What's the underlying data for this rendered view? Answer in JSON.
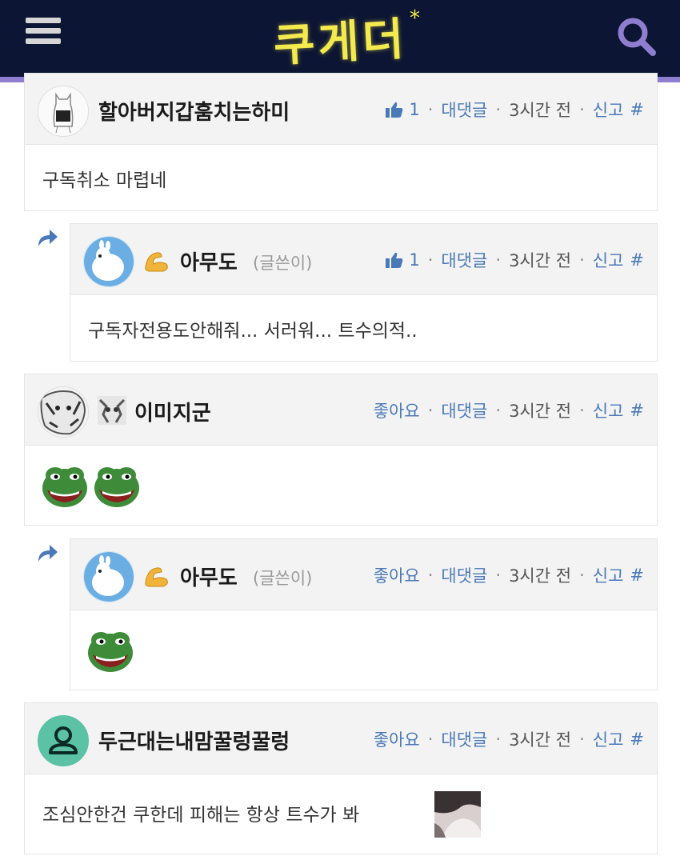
{
  "header": {
    "logo_text": "쿠게더",
    "logo_star": "*",
    "colors": {
      "bar": "#0c1533",
      "accent": "#8f7ed0",
      "logo": "#f3ea4e"
    },
    "icons": {
      "menu": "hamburger-icon",
      "search": "search-icon"
    }
  },
  "comments": [
    {
      "name": "할아버지갑훔치는하미",
      "likes": "1",
      "reply": "대댓글",
      "time": "3시간 전",
      "report": "신고",
      "hash": "#",
      "text": "구독취소 마렵네"
    },
    {
      "name": "아무도",
      "writer_tag": "(글쓴이)",
      "likes": "1",
      "reply": "대댓글",
      "time": "3시간 전",
      "report": "신고",
      "hash": "#",
      "text": "구독자전용도안해줘... 서러워... 트수의적.."
    },
    {
      "name": "이미지군",
      "like_label": "좋아요",
      "reply": "대댓글",
      "time": "3시간 전",
      "report": "신고",
      "hash": "#"
    },
    {
      "name": "아무도",
      "writer_tag": "(글쓴이)",
      "like_label": "좋아요",
      "reply": "대댓글",
      "time": "3시간 전",
      "report": "신고",
      "hash": "#"
    },
    {
      "name": "두근대는내맘꿀렁꿀렁",
      "like_label": "좋아요",
      "reply": "대댓글",
      "time": "3시간 전",
      "report": "신고",
      "hash": "#",
      "text": "조심안한건 쿠한데 피해는 항상 트수가 봐"
    }
  ]
}
